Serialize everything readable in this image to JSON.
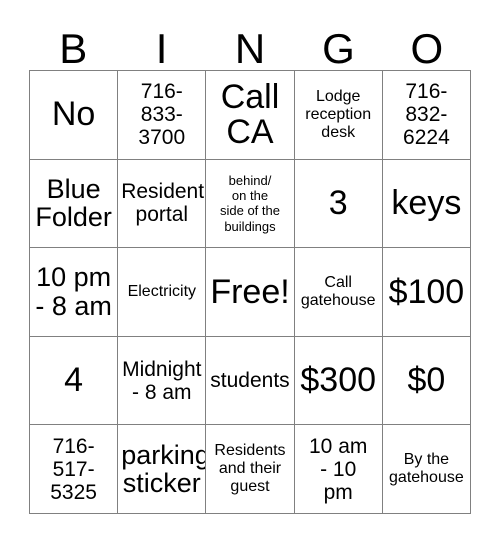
{
  "card": {
    "headers": [
      "B",
      "I",
      "N",
      "G",
      "O"
    ],
    "rows": [
      [
        {
          "text": "No",
          "size": "t-xl"
        },
        {
          "text": "716-\n833-\n3700",
          "size": "t-md"
        },
        {
          "text": "Call\nCA",
          "size": "t-xl"
        },
        {
          "text": "Lodge\nreception\ndesk",
          "size": "t-sm"
        },
        {
          "text": "716-\n832-\n6224",
          "size": "t-md"
        }
      ],
      [
        {
          "text": "Blue\nFolder",
          "size": "t-lg"
        },
        {
          "text": "Resident\nportal",
          "size": "t-md"
        },
        {
          "text": "behind/\non the\nside of the\nbuildings",
          "size": "t-xs"
        },
        {
          "text": "3",
          "size": "t-xl"
        },
        {
          "text": "keys",
          "size": "t-xl"
        }
      ],
      [
        {
          "text": "10 pm\n- 8 am",
          "size": "t-lg"
        },
        {
          "text": "Electricity",
          "size": "t-sm"
        },
        {
          "text": "Free!",
          "size": "t-xl"
        },
        {
          "text": "Call\ngatehouse",
          "size": "t-sm"
        },
        {
          "text": "$100",
          "size": "t-xl"
        }
      ],
      [
        {
          "text": "4",
          "size": "t-xl"
        },
        {
          "text": "Midnight\n- 8 am",
          "size": "t-md"
        },
        {
          "text": "students",
          "size": "t-md"
        },
        {
          "text": "$300",
          "size": "t-xl"
        },
        {
          "text": "$0",
          "size": "t-xl"
        }
      ],
      [
        {
          "text": "716-\n517-\n5325",
          "size": "t-md"
        },
        {
          "text": "parking\nsticker",
          "size": "t-lg"
        },
        {
          "text": "Residents\nand their\nguest",
          "size": "t-sm"
        },
        {
          "text": "10 am\n- 10\npm",
          "size": "t-md"
        },
        {
          "text": "By the\ngatehouse",
          "size": "t-sm"
        }
      ]
    ]
  },
  "colors": {
    "background": "#ffffff",
    "text": "#000000",
    "grid_line": "#808080"
  }
}
